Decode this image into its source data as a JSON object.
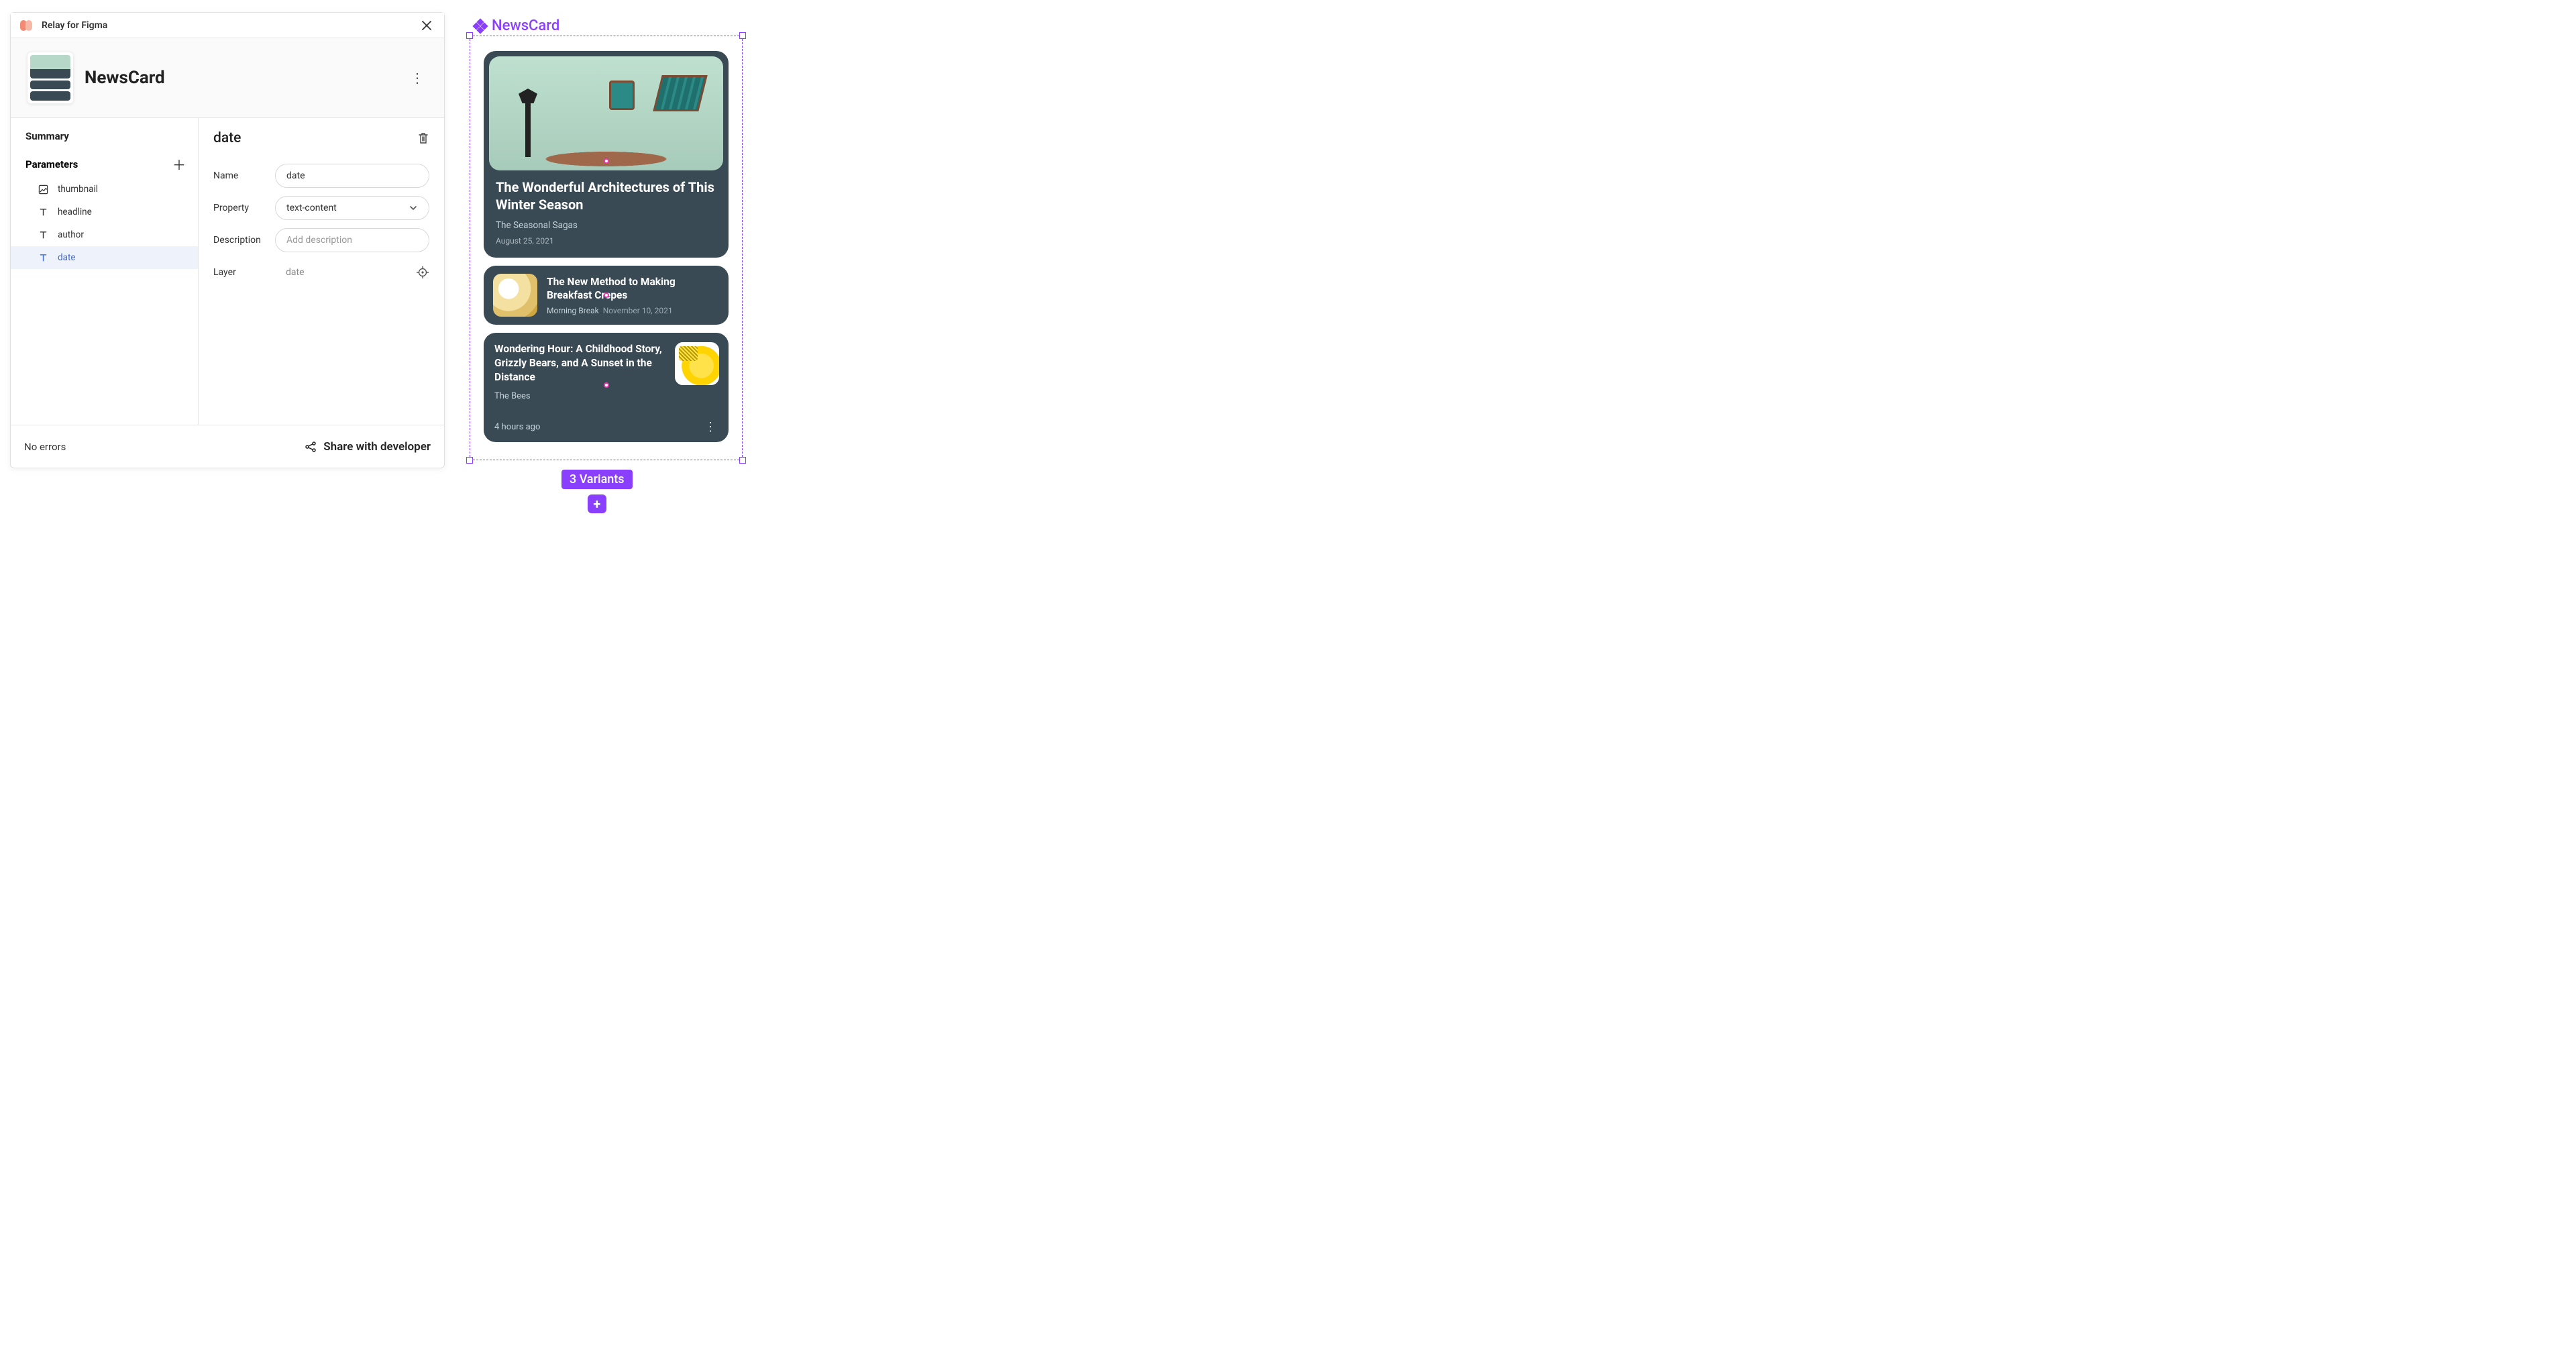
{
  "plugin": {
    "title": "Relay for Figma",
    "componentName": "NewsCard",
    "sections": {
      "summary": "Summary",
      "parameters": "Parameters"
    },
    "parameters": [
      {
        "kind": "image",
        "name": "thumbnail"
      },
      {
        "kind": "text",
        "name": "headline"
      },
      {
        "kind": "text",
        "name": "author"
      },
      {
        "kind": "text",
        "name": "date",
        "selected": true
      }
    ],
    "editor": {
      "title": "date",
      "fields": {
        "nameLabel": "Name",
        "nameValue": "date",
        "propertyLabel": "Property",
        "propertyValue": "text-content",
        "descriptionLabel": "Description",
        "descriptionPlaceholder": "Add description",
        "layerLabel": "Layer",
        "layerValue": "date"
      }
    },
    "footer": {
      "status": "No errors",
      "share": "Share with developer"
    }
  },
  "canvas": {
    "componentLabel": "NewsCard",
    "variantsBadge": "3 Variants",
    "cards": {
      "hero": {
        "headline": "The Wonderful Architectures of This Winter Season",
        "author": "The Seasonal Sagas",
        "date": "August 25, 2021"
      },
      "row": {
        "headline": "The New Method to Making Breakfast Crepes",
        "author": "Morning Break",
        "date": "November 10, 2021"
      },
      "audio": {
        "headline": "Wondering Hour: A Childhood Story, Grizzly Bears, and A Sunset in the Distance",
        "author": "The Bees",
        "ago": "4 hours ago"
      }
    }
  }
}
